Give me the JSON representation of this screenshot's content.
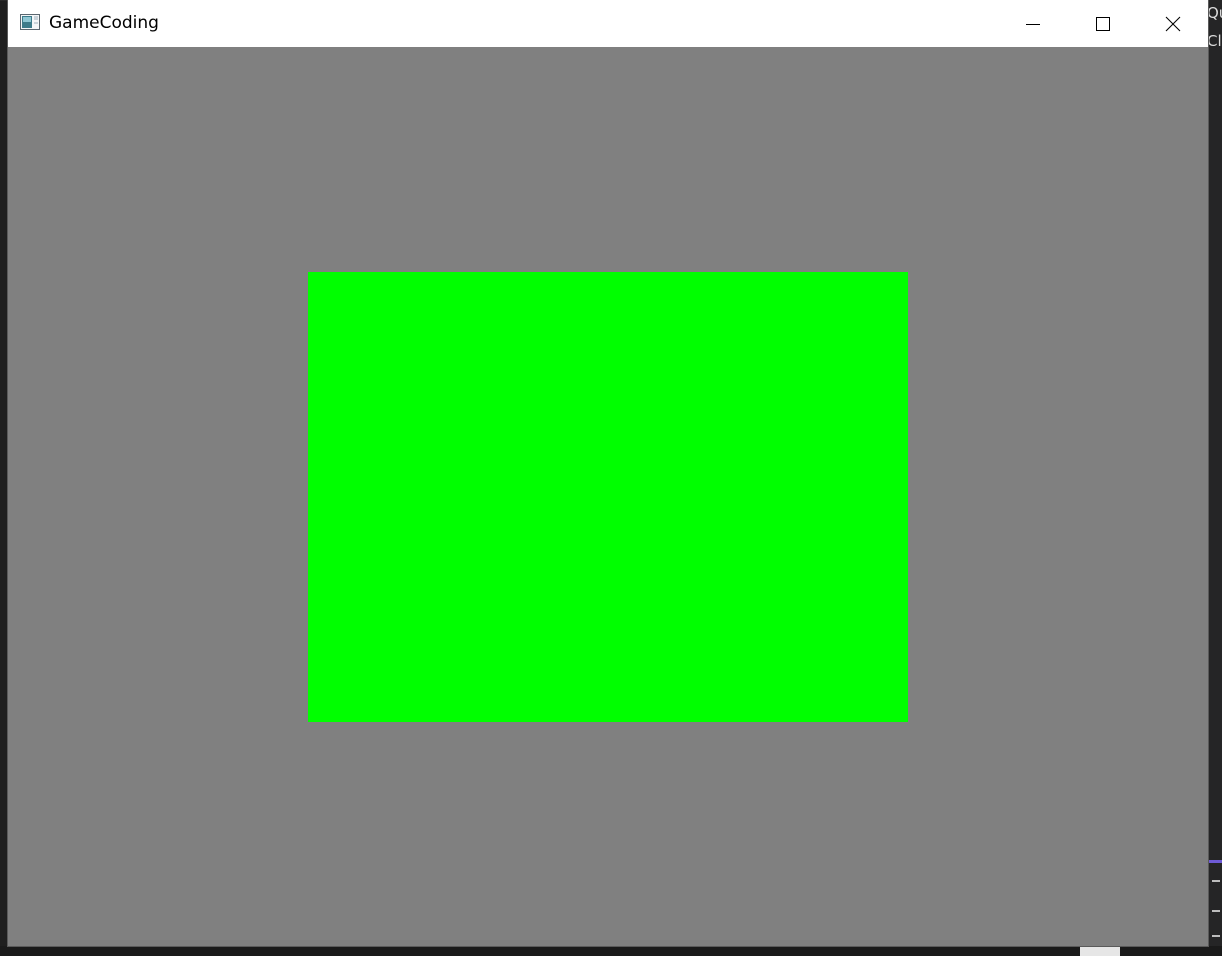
{
  "window": {
    "title": "GameCoding",
    "background_color": "#808080",
    "controls": {
      "minimize_icon": "minimize-icon",
      "maximize_icon": "maximize-icon",
      "close_icon": "close-icon"
    }
  },
  "canvas": {
    "shape": "rectangle",
    "fill_color": "#00ff00"
  },
  "background_app": {
    "text_lines": [
      "Qu",
      "Cli"
    ]
  }
}
